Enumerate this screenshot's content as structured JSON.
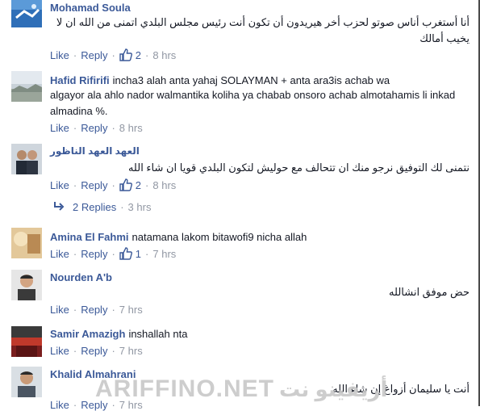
{
  "comments": [
    {
      "name": "Mohamad Soula",
      "text": "أنا أستغرب أناس صوتو لحزب أخر هيريدون أن تكون أنت رئيس مجلس البلدي اتمنى من الله ان لا يخيب أمالك",
      "like": "Like",
      "reply": "Reply",
      "likes": "2",
      "time": "8 hrs"
    },
    {
      "name": "Hafid Rifirifi",
      "text_inline": "incha3 alah anta yahaj SOLAYMAN + anta ara3is achab wa",
      "text": "algayor ala ahlo nador walmantika koliha ya chabab onsoro achab almotahamis li inkad almadina %.",
      "like": "Like",
      "reply": "Reply",
      "time": "8 hrs"
    },
    {
      "name": "العهد العهد الناظور",
      "text": "نتمنى لك التوفيق نرجو منك ان تتحالف مع حوليش لتكون البلدي قويا ان شاء الله",
      "like": "Like",
      "reply": "Reply",
      "likes": "2",
      "time": "8 hrs",
      "replies": "2 Replies",
      "replies_time": "3 hrs"
    },
    {
      "name": "Amina El Fahmi",
      "text_inline": "natamana lakom bitawofi9 nicha allah",
      "like": "Like",
      "reply": "Reply",
      "likes": "1",
      "time": "7 hrs"
    },
    {
      "name": "Nourden A'b",
      "text": "حض موفق انشالله",
      "like": "Like",
      "reply": "Reply",
      "time": "7 hrs"
    },
    {
      "name": "Samir Amazigh",
      "text_inline": "inshallah nta",
      "like": "Like",
      "reply": "Reply",
      "time": "7 hrs"
    },
    {
      "name": "Khalid Almahrani",
      "text": "أنت يا سليمان أزواغ إن شاء الله",
      "like": "Like",
      "reply": "Reply",
      "time": "7 hrs"
    }
  ],
  "watermark": {
    "text": "ARIFFINO.NET",
    "arabic": "أريفينو نت"
  },
  "colors": {
    "link": "#3b5998",
    "muted": "#9197a3",
    "text": "#141823"
  }
}
